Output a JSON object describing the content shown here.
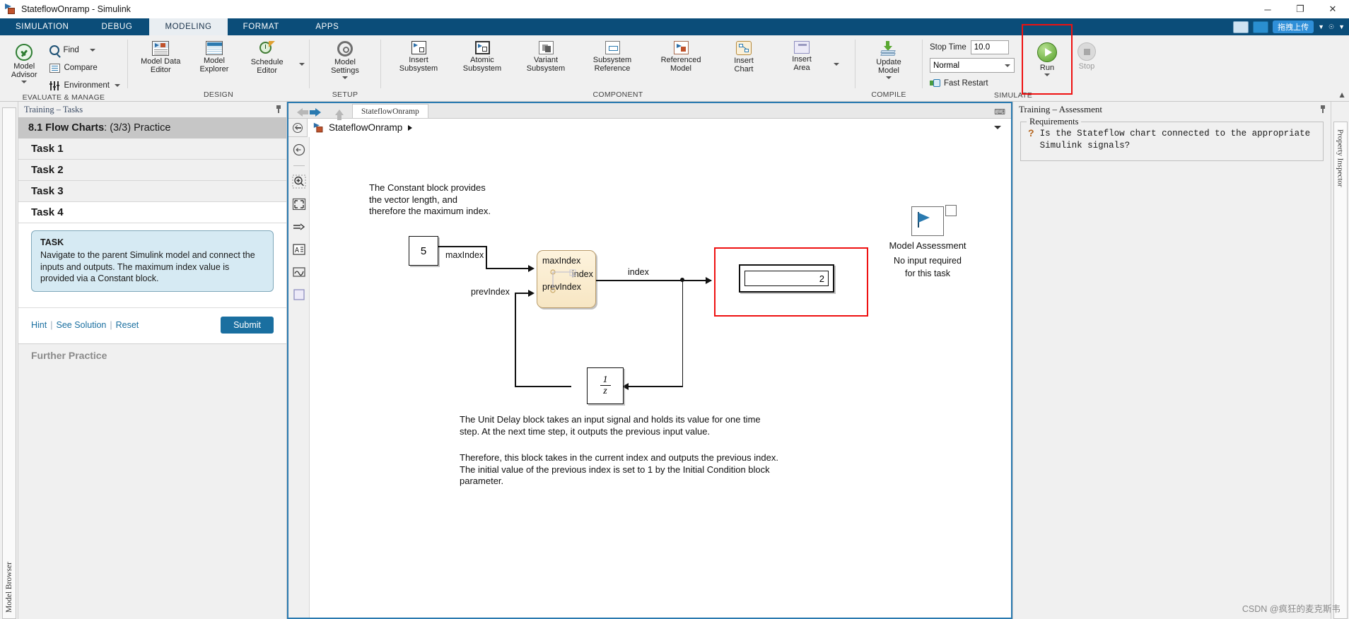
{
  "window": {
    "title": "StateflowOnramp - Simulink",
    "minimize": "─",
    "maximize": "❐",
    "close": "✕"
  },
  "ribbon_tabs": [
    {
      "label": "SIMULATION",
      "active": false
    },
    {
      "label": "DEBUG",
      "active": false
    },
    {
      "label": "MODELING",
      "active": true
    },
    {
      "label": "FORMAT",
      "active": false
    },
    {
      "label": "APPS",
      "active": false
    }
  ],
  "tabstrip_right": {
    "upload_label": "拖拽上传"
  },
  "ribbon": {
    "groups": [
      {
        "name": "EVALUATE & MANAGE",
        "big": [
          {
            "label": "Model\nAdvisor",
            "icon": "model-advisor-icon",
            "has_caret": true
          }
        ],
        "small": [
          {
            "label": "Find",
            "icon": "search-icon",
            "has_caret": true
          },
          {
            "label": "Compare",
            "icon": "compare-icon",
            "has_caret": false
          },
          {
            "label": "Environment",
            "icon": "environment-icon",
            "has_caret": true
          }
        ]
      },
      {
        "name": "DESIGN",
        "items": [
          {
            "label": "Model Data\nEditor",
            "icon": "model-data-editor-icon"
          },
          {
            "label": "Model\nExplorer",
            "icon": "model-explorer-icon"
          },
          {
            "label": "Schedule\nEditor",
            "icon": "schedule-editor-icon"
          }
        ]
      },
      {
        "name": "SETUP",
        "items": [
          {
            "label": "Model\nSettings",
            "icon": "gear-icon",
            "has_caret": true
          }
        ]
      },
      {
        "name": "COMPONENT",
        "items": [
          {
            "label": "Insert\nSubsystem",
            "icon": "insert-subsystem-icon"
          },
          {
            "label": "Atomic\nSubsystem",
            "icon": "atomic-subsystem-icon"
          },
          {
            "label": "Variant\nSubsystem",
            "icon": "variant-subsystem-icon"
          },
          {
            "label": "Subsystem\nReference",
            "icon": "subsystem-reference-icon"
          },
          {
            "label": "Referenced\nModel",
            "icon": "referenced-model-icon"
          },
          {
            "label": "Insert\nChart",
            "icon": "insert-chart-icon"
          },
          {
            "label": "Insert\nArea",
            "icon": "insert-area-icon"
          }
        ]
      },
      {
        "name": "COMPILE",
        "items": [
          {
            "label": "Update\nModel",
            "icon": "update-model-icon",
            "has_caret": true
          }
        ]
      },
      {
        "name": "SIMULATE",
        "stop_time_label": "Stop Time",
        "stop_time_value": "10.0",
        "sim_mode": "Normal",
        "fast_restart_label": "Fast Restart",
        "run_label": "Run",
        "stop_label": "Stop"
      }
    ]
  },
  "left_dock": {
    "vertical_tab": "Model Browser"
  },
  "left_panel": {
    "header": "Training – Tasks",
    "course_title_bold": "8.1 Flow Charts",
    "course_title_rest": ":  (3/3) Practice",
    "tasks": [
      {
        "label": "Task 1"
      },
      {
        "label": "Task 2"
      },
      {
        "label": "Task 3"
      },
      {
        "label": "Task 4"
      }
    ],
    "task_box": {
      "heading": "TASK",
      "body": "Navigate to the parent Simulink model and connect the inputs and outputs. The maximum index value is provided via a Constant block."
    },
    "links": {
      "hint": "Hint",
      "see_solution": "See Solution",
      "reset": "Reset",
      "divider": "|"
    },
    "submit_label": "Submit",
    "further_practice": "Further Practice"
  },
  "canvas": {
    "tab_label": "StateflowOnramp",
    "breadcrumb_name": "StateflowOnramp",
    "tools": [
      "navigate-back-icon",
      "zoom-in-icon",
      "fit-to-view-icon",
      "signal-routing-icon",
      "annotation-icon",
      "scope-icon",
      "area-icon"
    ],
    "notes": {
      "top": "The Constant block provides\nthe vector length, and\ntherefore the maximum index.",
      "bottom1": "The Unit Delay block takes an input signal and holds its value for one time\nstep. At the next time step, it outputs the previous input value.",
      "bottom2": "Therefore, this block takes in the current index and outputs the previous index.\nThe initial value of the previous index is set to 1 by the Initial Condition block\nparameter."
    },
    "blocks": {
      "constant_value": "5",
      "chart_in1": "maxIndex",
      "chart_in2": "prevIndex",
      "chart_out": "index",
      "unit_delay_num": "1",
      "unit_delay_den": "z",
      "display_value": "2"
    },
    "signal_labels": {
      "max_index": "maxIndex",
      "prev_index": "prevIndex",
      "index": "index"
    },
    "assessment_widget": {
      "title": "Model Assessment",
      "line1": "No input required",
      "line2": "for this task"
    }
  },
  "right_panel": {
    "header": "Training – Assessment",
    "fieldset_legend": "Requirements",
    "requirement_marker": "?",
    "requirement_text": "Is the Stateflow chart connected to the appropriate Simulink signals?",
    "vertical_tab": "Property Inspector"
  },
  "watermark": "CSDN @疯狂的麦克斯韦",
  "colors": {
    "ribbon_blue": "#0b4d79",
    "accent_blue": "#1a6fa0",
    "highlight_red": "#ee1111",
    "chart_fill": "#fdf3dd"
  }
}
